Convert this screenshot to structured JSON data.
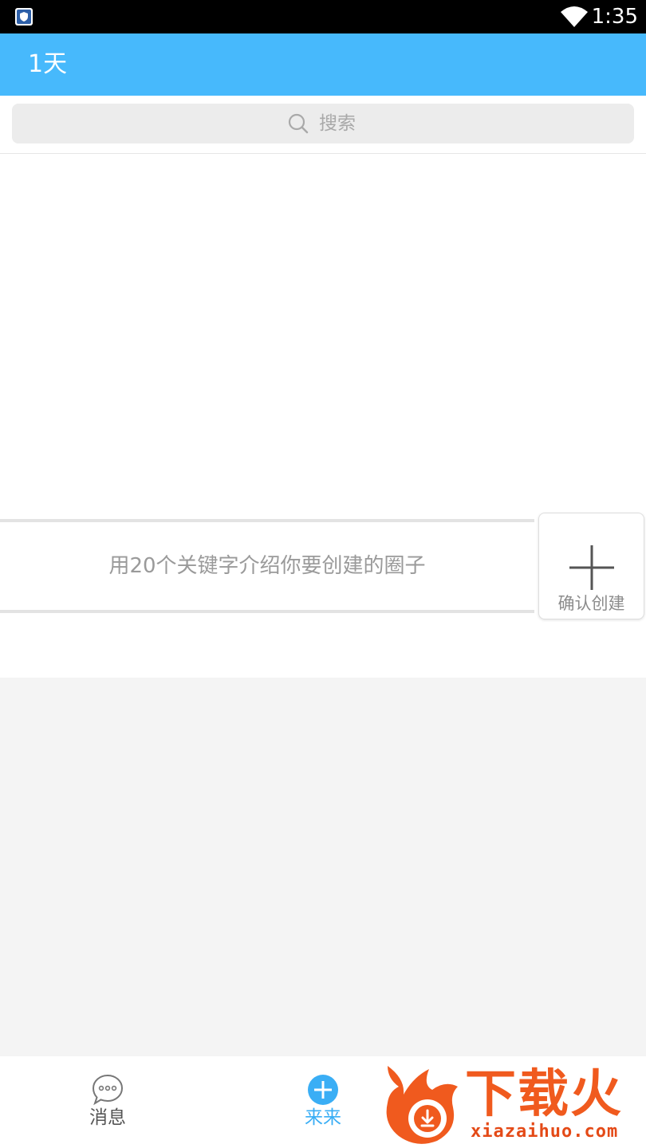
{
  "status_bar": {
    "time": "1:35",
    "app_icon": "shield-app-icon",
    "wifi_icon": "wifi-icon"
  },
  "header": {
    "title": "1天"
  },
  "search": {
    "placeholder": "搜索",
    "icon": "search-icon"
  },
  "create_circle": {
    "hint": "用20个关键字介绍你要创建的圈子",
    "confirm_label": "确认创建",
    "confirm_icon": "plus-icon"
  },
  "bottom_nav": {
    "items": [
      {
        "label": "消息",
        "icon": "chat-bubble-icon",
        "active": false
      },
      {
        "label": "来来",
        "icon": "plus-circle-icon",
        "active": true
      }
    ]
  },
  "watermark": {
    "text": "下载火",
    "domain": "xiazaihuo.com"
  },
  "colors": {
    "header_blue": "#47b9fc",
    "accent_blue": "#3aaef5",
    "watermark_orange": "#f05a1e"
  }
}
